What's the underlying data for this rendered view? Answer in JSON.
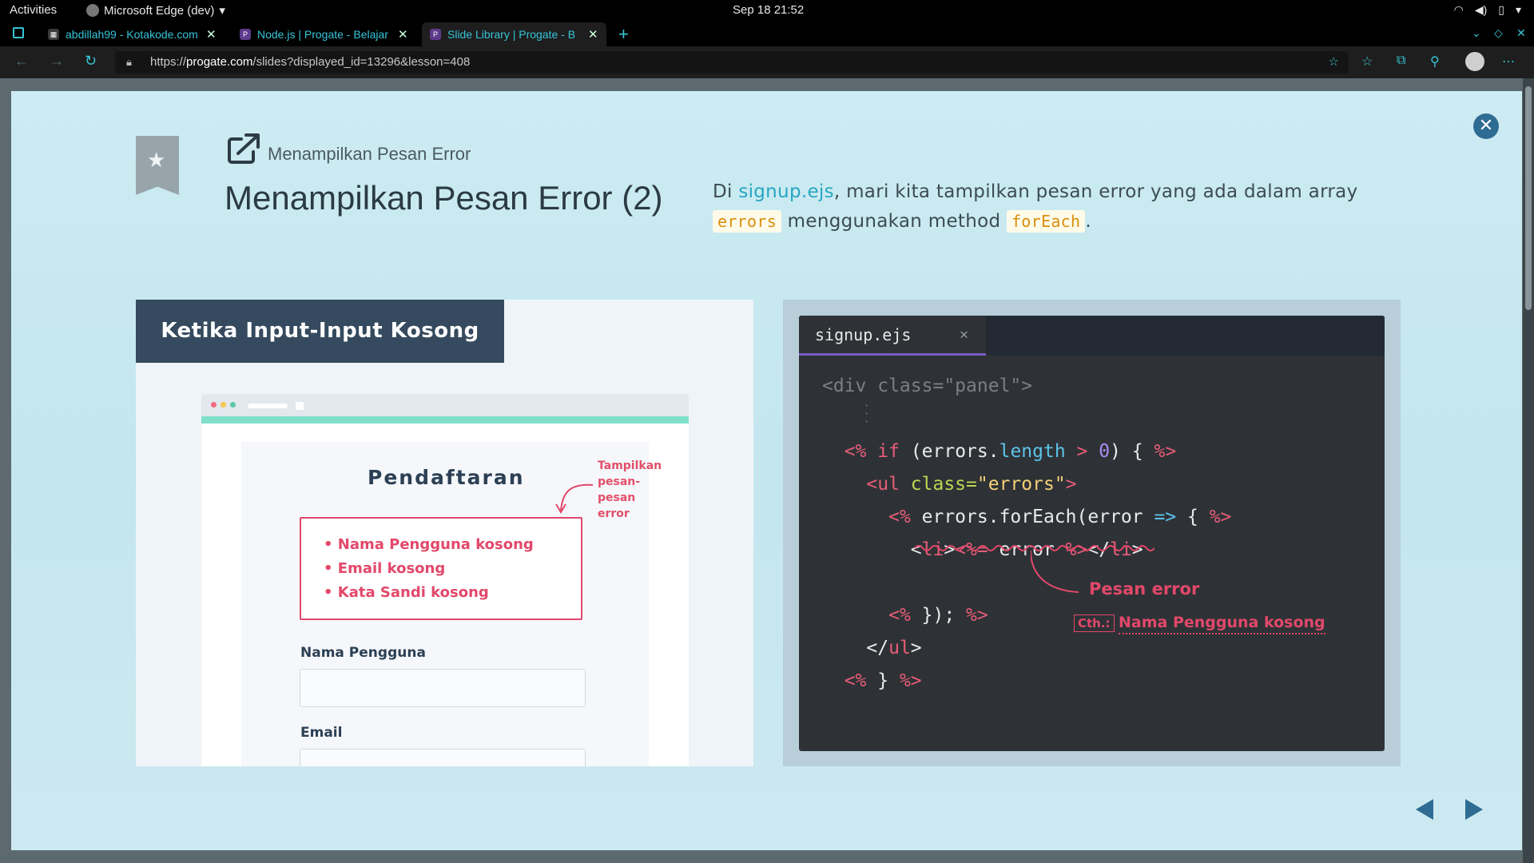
{
  "topbar": {
    "activities": "Activities",
    "app_name": "Microsoft Edge (dev)",
    "clock": "Sep 18  21:52"
  },
  "tabs": [
    {
      "title": "abdillah99 - Kotakode.com",
      "icon": "kotakode-favicon"
    },
    {
      "title": "Node.js | Progate - Belajar",
      "icon": "progate-favicon"
    },
    {
      "title": "Slide Library | Progate - B",
      "icon": "progate-favicon",
      "active": true
    }
  ],
  "address": {
    "url_prefix": "https://",
    "url_host": "progate.com",
    "url_path": "/slides?displayed_id=13296&lesson=408"
  },
  "slide": {
    "lesson_name": "Menampilkan Pesan Error",
    "title": "Menampilkan Pesan Error (2)",
    "desc_part1": "Di ",
    "desc_link": "signup.ejs",
    "desc_part2": ", mari kita tampilkan pesan error yang ada dalam array",
    "desc_tag1": "errors",
    "desc_part3": " menggunakan method ",
    "desc_tag2": "forEach",
    "desc_part4": "."
  },
  "left_panel": {
    "heading": "Ketika Input-Input Kosong",
    "form_title": "Pendaftaran",
    "annotation_line1": "Tampilkan",
    "annotation_line2": "pesan-pesan error",
    "errors": [
      "Nama Pengguna kosong",
      "Email kosong",
      "Kata Sandi kosong"
    ],
    "field1_label": "Nama Pengguna",
    "field2_label": "Email"
  },
  "code_panel": {
    "filename": "signup.ejs",
    "annotation_title": "Pesan error",
    "cth_label": "Cth.:",
    "cth_text": "Nama Pengguna kosong"
  },
  "colors": {
    "accent": "#2f6c93",
    "error": "#e2486a",
    "code_bg": "#2e3236"
  }
}
